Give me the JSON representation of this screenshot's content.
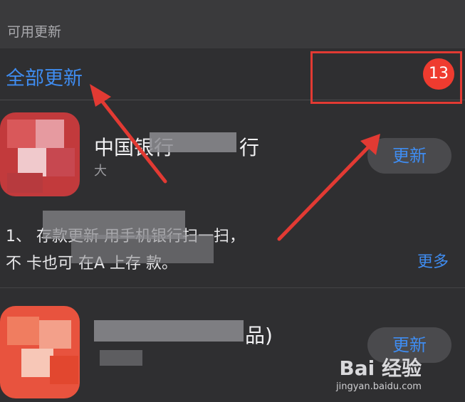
{
  "section": {
    "title": "可用更新"
  },
  "update_all": {
    "label": "全部更新"
  },
  "badge": {
    "count": "13"
  },
  "apps": [
    {
      "name_visible": "中国银行",
      "name_tail": "行",
      "sub_visible": "大",
      "update_label": "更新",
      "notes_line1": "1、 存款更新 用手机银行扫一扫，",
      "notes_line2": "不 卡也可 在A 上存 款。",
      "more_label": "更多"
    },
    {
      "name_tail": "品)",
      "update_label": "更新"
    }
  ],
  "watermark": {
    "brand": "Bai 经验",
    "url": "jingyan.baidu.com"
  },
  "colors": {
    "accent": "#3f8cf0",
    "badge": "#ef3b2f",
    "annotation": "#e23a33"
  }
}
